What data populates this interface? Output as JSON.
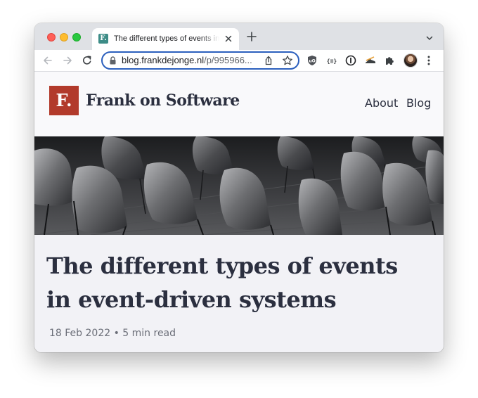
{
  "browser": {
    "tab": {
      "favicon_letter": "F.",
      "title": "The different types of events in event-driven systems"
    },
    "address": {
      "host": "blog.frankdejonge.nl",
      "path": "/p/995966..."
    },
    "icons": [
      "back-icon",
      "forward-icon",
      "reload-icon",
      "lock-icon",
      "share-icon",
      "star-icon",
      "shield-extension-icon",
      "json-extension-icon",
      "password-extension-icon",
      "shoe-extension-icon",
      "puzzle-extensions-icon",
      "profile-avatar",
      "more-menu-icon"
    ]
  },
  "site": {
    "logo_letter": "F.",
    "title": "Frank on Software",
    "nav": [
      {
        "label": "About"
      },
      {
        "label": "Blog"
      }
    ]
  },
  "article": {
    "title": "The different types of events in event-driven systems",
    "meta": "18 Feb 2022 • 5 min read"
  },
  "colors": {
    "logo": "#b23a2b",
    "text": "#2b2f3f",
    "page_bg": "#f2f2f6",
    "omnibox_focus": "#2b5fbd",
    "favicon": "#3d8c87"
  }
}
